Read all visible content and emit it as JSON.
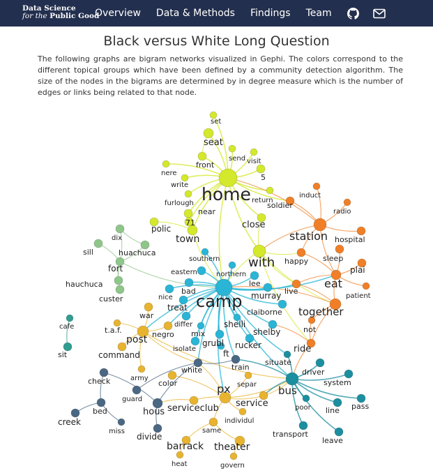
{
  "brand": {
    "line1": "Data Science",
    "line2_italic": "for the",
    "line2_bold": "Public Good"
  },
  "nav": {
    "items": [
      {
        "label": "Overview"
      },
      {
        "label": "Data & Methods"
      },
      {
        "label": "Findings"
      },
      {
        "label": "Team"
      }
    ],
    "icons": [
      "github-icon",
      "mail-icon"
    ]
  },
  "page": {
    "title": "Black versus White Long Question",
    "description": "The following graphs are bigram networks visualized in Gephi. The colors correspond to the different topical groups which have been defined by a community detection algorithm. The size of the nodes in the bigrams are determined by in degree measure which is the number of edges or links being related to that node."
  },
  "colors": {
    "navbar": "#232f4e",
    "yellow": "#d4e82c",
    "orange": "#f07f27",
    "cyan": "#2ab5d6",
    "green": "#8fc68a",
    "teal": "#2f9d8f",
    "gold": "#e8b32e",
    "slate": "#4a6783",
    "teal2": "#1b8fa0"
  },
  "network": {
    "nodes": [
      {
        "id": "set",
        "label": "set",
        "group": "yellow"
      },
      {
        "id": "seat",
        "label": "seat",
        "group": "yellow"
      },
      {
        "id": "send",
        "label": "send",
        "group": "yellow"
      },
      {
        "id": "visit",
        "label": "visit",
        "group": "yellow"
      },
      {
        "id": "front",
        "label": "front",
        "group": "yellow"
      },
      {
        "id": "nere",
        "label": "nere",
        "group": "yellow"
      },
      {
        "id": "5",
        "label": "5",
        "group": "yellow"
      },
      {
        "id": "write",
        "label": "write",
        "group": "yellow"
      },
      {
        "id": "home",
        "label": "home",
        "group": "yellow"
      },
      {
        "id": "return",
        "label": "return",
        "group": "yellow"
      },
      {
        "id": "furlough",
        "label": "furlough",
        "group": "yellow"
      },
      {
        "id": "near",
        "label": "near",
        "group": "yellow"
      },
      {
        "id": "71",
        "label": "71",
        "group": "yellow"
      },
      {
        "id": "polic",
        "label": "polic",
        "group": "yellow"
      },
      {
        "id": "town",
        "label": "town",
        "group": "yellow"
      },
      {
        "id": "close",
        "label": "close",
        "group": "yellow"
      },
      {
        "id": "with",
        "label": "with",
        "group": "yellow"
      },
      {
        "id": "induct",
        "label": "induct",
        "group": "orange"
      },
      {
        "id": "radio",
        "label": "radio",
        "group": "orange"
      },
      {
        "id": "soldier",
        "label": "soldier",
        "group": "orange"
      },
      {
        "id": "station",
        "label": "station",
        "group": "orange"
      },
      {
        "id": "hospital",
        "label": "hospital",
        "group": "orange"
      },
      {
        "id": "happy",
        "label": "happy",
        "group": "orange"
      },
      {
        "id": "sleep",
        "label": "sleep",
        "group": "orange"
      },
      {
        "id": "plai",
        "label": "plai",
        "group": "orange"
      },
      {
        "id": "eat",
        "label": "eat",
        "group": "orange"
      },
      {
        "id": "live",
        "label": "live",
        "group": "orange"
      },
      {
        "id": "patient",
        "label": "patient",
        "group": "orange"
      },
      {
        "id": "together",
        "label": "together",
        "group": "orange"
      },
      {
        "id": "not",
        "label": "not",
        "group": "orange"
      },
      {
        "id": "ride",
        "label": "ride",
        "group": "orange"
      },
      {
        "id": "dix",
        "label": "dix",
        "group": "green"
      },
      {
        "id": "huachuca",
        "label": "huachuca",
        "group": "green"
      },
      {
        "id": "sill",
        "label": "sill",
        "group": "green"
      },
      {
        "id": "fort",
        "label": "fort",
        "group": "green"
      },
      {
        "id": "hauchuca",
        "label": "hauchuca",
        "group": "green"
      },
      {
        "id": "custer",
        "label": "custer",
        "group": "green"
      },
      {
        "id": "southern",
        "label": "southern",
        "group": "cyan"
      },
      {
        "id": "eastern",
        "label": "eastern",
        "group": "cyan"
      },
      {
        "id": "northern",
        "label": "northern",
        "group": "cyan"
      },
      {
        "id": "bad",
        "label": "bad",
        "group": "cyan"
      },
      {
        "id": "lee",
        "label": "lee",
        "group": "cyan"
      },
      {
        "id": "camp",
        "label": "camp",
        "group": "cyan"
      },
      {
        "id": "nice",
        "label": "nice",
        "group": "cyan"
      },
      {
        "id": "murray",
        "label": "murray",
        "group": "cyan"
      },
      {
        "id": "treat",
        "label": "treat",
        "group": "cyan"
      },
      {
        "id": "claiborne",
        "label": "claiborne",
        "group": "cyan"
      },
      {
        "id": "differ",
        "label": "differ",
        "group": "cyan"
      },
      {
        "id": "shelli",
        "label": "shelli",
        "group": "cyan"
      },
      {
        "id": "shelby",
        "label": "shelby",
        "group": "cyan"
      },
      {
        "id": "mix",
        "label": "mix",
        "group": "cyan"
      },
      {
        "id": "grubl",
        "label": "grubl",
        "group": "cyan"
      },
      {
        "id": "rucker",
        "label": "rucker",
        "group": "cyan"
      },
      {
        "id": "isolate",
        "label": "isolate",
        "group": "cyan"
      },
      {
        "id": "ft",
        "label": "ft",
        "group": "cyan"
      },
      {
        "id": "cafe",
        "label": "cafe",
        "group": "teal"
      },
      {
        "id": "sit",
        "label": "sit",
        "group": "teal"
      },
      {
        "id": "war",
        "label": "war",
        "group": "gold"
      },
      {
        "id": "taf",
        "label": "t.a.f.",
        "group": "gold"
      },
      {
        "id": "negro",
        "label": "negro",
        "group": "gold"
      },
      {
        "id": "post",
        "label": "post",
        "group": "gold"
      },
      {
        "id": "command",
        "label": "command",
        "group": "gold"
      },
      {
        "id": "army",
        "label": "army",
        "group": "gold"
      },
      {
        "id": "color",
        "label": "color",
        "group": "gold"
      },
      {
        "id": "px",
        "label": "px",
        "group": "gold"
      },
      {
        "id": "separ",
        "label": "separ",
        "group": "gold"
      },
      {
        "id": "service",
        "label": "service",
        "group": "gold"
      },
      {
        "id": "serviceclub",
        "label": "serviceclub",
        "group": "gold"
      },
      {
        "id": "individul",
        "label": "individul",
        "group": "gold"
      },
      {
        "id": "same",
        "label": "same",
        "group": "gold"
      },
      {
        "id": "barrack",
        "label": "barrack",
        "group": "gold"
      },
      {
        "id": "theater",
        "label": "theater",
        "group": "gold"
      },
      {
        "id": "heat",
        "label": "heat",
        "group": "gold"
      },
      {
        "id": "govern",
        "label": "govern",
        "group": "gold"
      },
      {
        "id": "white",
        "label": "white",
        "group": "slate"
      },
      {
        "id": "train",
        "label": "train",
        "group": "slate"
      },
      {
        "id": "check",
        "label": "check",
        "group": "slate"
      },
      {
        "id": "guard",
        "label": "guard",
        "group": "slate"
      },
      {
        "id": "hous",
        "label": "hous",
        "group": "slate"
      },
      {
        "id": "bed",
        "label": "bed",
        "group": "slate"
      },
      {
        "id": "creek",
        "label": "creek",
        "group": "slate"
      },
      {
        "id": "miss",
        "label": "miss",
        "group": "slate"
      },
      {
        "id": "divide",
        "label": "divide",
        "group": "slate"
      },
      {
        "id": "situate",
        "label": "situate",
        "group": "teal2"
      },
      {
        "id": "driver",
        "label": "driver",
        "group": "teal2"
      },
      {
        "id": "bus",
        "label": "bus",
        "group": "teal2"
      },
      {
        "id": "system",
        "label": "system",
        "group": "teal2"
      },
      {
        "id": "poor",
        "label": "poor",
        "group": "teal2"
      },
      {
        "id": "line",
        "label": "line",
        "group": "teal2"
      },
      {
        "id": "pass",
        "label": "pass",
        "group": "teal2"
      },
      {
        "id": "transport",
        "label": "transport",
        "group": "teal2"
      },
      {
        "id": "leave",
        "label": "leave",
        "group": "teal2"
      }
    ],
    "edges": [
      [
        "home",
        "set"
      ],
      [
        "home",
        "seat"
      ],
      [
        "home",
        "send"
      ],
      [
        "home",
        "visit"
      ],
      [
        "home",
        "front"
      ],
      [
        "home",
        "nere"
      ],
      [
        "home",
        "5"
      ],
      [
        "home",
        "write"
      ],
      [
        "home",
        "return"
      ],
      [
        "home",
        "furlough"
      ],
      [
        "home",
        "near"
      ],
      [
        "home",
        "71"
      ],
      [
        "home",
        "town"
      ],
      [
        "home",
        "close"
      ],
      [
        "home",
        "soldier"
      ],
      [
        "home",
        "with"
      ],
      [
        "home",
        "camp"
      ],
      [
        "seat",
        "front"
      ],
      [
        "town",
        "polic"
      ],
      [
        "town",
        "71"
      ],
      [
        "town",
        "camp"
      ],
      [
        "close",
        "with"
      ],
      [
        "with",
        "camp"
      ],
      [
        "with",
        "happy"
      ],
      [
        "with",
        "live"
      ],
      [
        "with",
        "together"
      ],
      [
        "with",
        "ride"
      ],
      [
        "station",
        "induct"
      ],
      [
        "station",
        "radio"
      ],
      [
        "station",
        "soldier"
      ],
      [
        "station",
        "hospital"
      ],
      [
        "station",
        "happy"
      ],
      [
        "station",
        "home"
      ],
      [
        "station",
        "with"
      ],
      [
        "station",
        "eat"
      ],
      [
        "eat",
        "sleep"
      ],
      [
        "eat",
        "plai"
      ],
      [
        "eat",
        "patient"
      ],
      [
        "eat",
        "live"
      ],
      [
        "eat",
        "happy"
      ],
      [
        "eat",
        "together"
      ],
      [
        "together",
        "live"
      ],
      [
        "together",
        "not"
      ],
      [
        "together",
        "camp"
      ],
      [
        "together",
        "ride"
      ],
      [
        "not",
        "ride"
      ],
      [
        "ride",
        "bus"
      ],
      [
        "ride",
        "shelby"
      ],
      [
        "fort",
        "dix"
      ],
      [
        "fort",
        "huachuca"
      ],
      [
        "fort",
        "sill"
      ],
      [
        "fort",
        "hauchuca"
      ],
      [
        "fort",
        "custer"
      ],
      [
        "fort",
        "camp"
      ],
      [
        "dix",
        "huachuca"
      ],
      [
        "camp",
        "southern"
      ],
      [
        "camp",
        "eastern"
      ],
      [
        "camp",
        "northern"
      ],
      [
        "camp",
        "bad"
      ],
      [
        "camp",
        "lee"
      ],
      [
        "camp",
        "nice"
      ],
      [
        "camp",
        "murray"
      ],
      [
        "camp",
        "treat"
      ],
      [
        "camp",
        "claiborne"
      ],
      [
        "camp",
        "differ"
      ],
      [
        "camp",
        "shelli"
      ],
      [
        "camp",
        "shelby"
      ],
      [
        "camp",
        "mix"
      ],
      [
        "camp",
        "grubl"
      ],
      [
        "camp",
        "rucker"
      ],
      [
        "camp",
        "isolate"
      ],
      [
        "camp",
        "ft"
      ],
      [
        "camp",
        "live"
      ],
      [
        "camp",
        "eat"
      ],
      [
        "camp",
        "bus"
      ],
      [
        "camp",
        "negro"
      ],
      [
        "camp",
        "post"
      ],
      [
        "camp",
        "white"
      ],
      [
        "camp",
        "situate"
      ],
      [
        "camp",
        "train"
      ],
      [
        "camp",
        "px"
      ],
      [
        "cafe",
        "sit"
      ],
      [
        "post",
        "war"
      ],
      [
        "post",
        "taf"
      ],
      [
        "post",
        "negro"
      ],
      [
        "post",
        "command"
      ],
      [
        "post",
        "army"
      ],
      [
        "post",
        "bus"
      ],
      [
        "post",
        "white"
      ],
      [
        "px",
        "separ"
      ],
      [
        "px",
        "service"
      ],
      [
        "px",
        "serviceclub"
      ],
      [
        "px",
        "individul"
      ],
      [
        "px",
        "same"
      ],
      [
        "px",
        "color"
      ],
      [
        "px",
        "white"
      ],
      [
        "px",
        "bus"
      ],
      [
        "same",
        "barrack"
      ],
      [
        "same",
        "theater"
      ],
      [
        "barrack",
        "heat"
      ],
      [
        "theater",
        "govern"
      ],
      [
        "service",
        "bus"
      ],
      [
        "serviceclub",
        "hous"
      ],
      [
        "white",
        "train"
      ],
      [
        "white",
        "hous"
      ],
      [
        "white",
        "guard"
      ],
      [
        "hous",
        "divide"
      ],
      [
        "hous",
        "check"
      ],
      [
        "check",
        "bed"
      ],
      [
        "bed",
        "creek"
      ],
      [
        "bed",
        "miss"
      ],
      [
        "bus",
        "situate"
      ],
      [
        "bus",
        "driver"
      ],
      [
        "bus",
        "system"
      ],
      [
        "bus",
        "poor"
      ],
      [
        "bus",
        "line"
      ],
      [
        "bus",
        "pass"
      ],
      [
        "bus",
        "transport"
      ],
      [
        "bus",
        "leave"
      ],
      [
        "bus",
        "service"
      ],
      [
        "bus",
        "train"
      ]
    ]
  }
}
